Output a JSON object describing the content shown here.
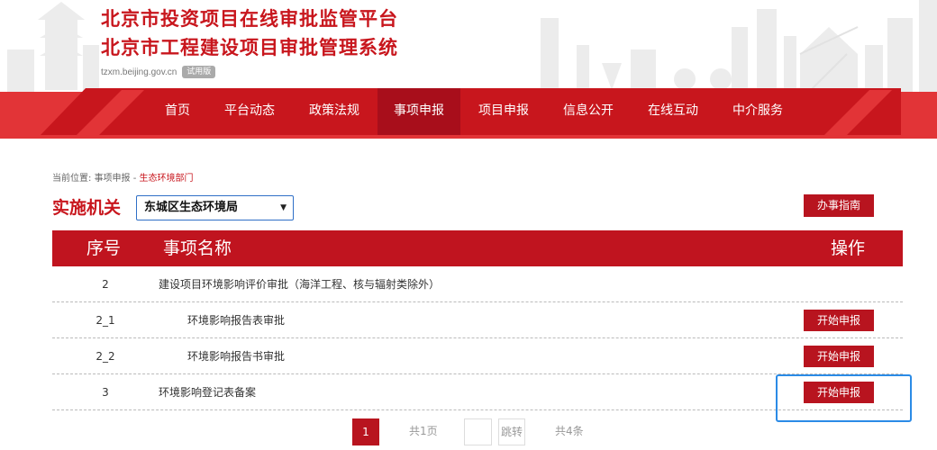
{
  "header": {
    "title_line1": "北京市投资项目在线审批监管平台",
    "title_line2": "北京市工程建设项目审批管理系统",
    "domain": "tzxm.beijing.gov.cn",
    "badge": "试用版"
  },
  "nav": {
    "items": [
      {
        "label": "首页"
      },
      {
        "label": "平台动态"
      },
      {
        "label": "政策法规"
      },
      {
        "label": "事项申报",
        "active": true
      },
      {
        "label": "项目申报"
      },
      {
        "label": "信息公开"
      },
      {
        "label": "在线互动"
      },
      {
        "label": "中介服务"
      }
    ]
  },
  "breadcrumb": {
    "prefix": "当前位置: ",
    "parent": "事项申报",
    "sep": " - ",
    "current": "生态环境部门"
  },
  "filter": {
    "label": "实施机关",
    "selected": "东城区生态环境局",
    "arrow": "▼",
    "guide_button": "办事指南"
  },
  "table": {
    "headers": {
      "num": "序号",
      "name": "事项名称",
      "op": "操作"
    },
    "rows": [
      {
        "num": "2",
        "name": "建设项目环境影响评价审批（海洋工程、核与辐射类除外）",
        "button": ""
      },
      {
        "num": "2_1",
        "name": "环境影响报告表审批",
        "button": "开始申报"
      },
      {
        "num": "2_2",
        "name": "环境影响报告书审批",
        "button": "开始申报"
      },
      {
        "num": "3",
        "name": "环境影响登记表备案",
        "button": "开始申报"
      }
    ]
  },
  "pagination": {
    "current": "1",
    "total_pages": "共1页",
    "jump_value": "",
    "jump_label": "跳转",
    "total_items": "共4条"
  },
  "colors": {
    "brand_red": "#c8161d",
    "button_red": "#b8141f",
    "nav_active": "#a80e1b",
    "highlight_blue": "#2b8be6"
  }
}
